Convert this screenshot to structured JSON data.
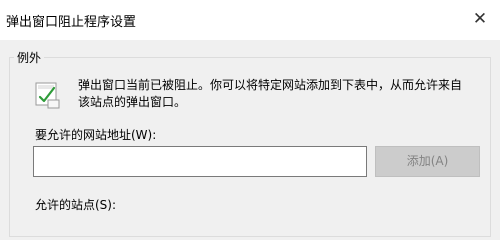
{
  "window": {
    "title": "弹出窗口阻止程序设置",
    "close_glyph": "✕"
  },
  "exceptions": {
    "legend": "例外",
    "info_text": "弹出窗口当前已被阻止。你可以将特定网站添加到下表中，从而允许来自该站点的弹出窗口。",
    "icon": "popup-blocked-icon"
  },
  "address": {
    "label": "要允许的网站地址(W):",
    "value": "",
    "placeholder": ""
  },
  "add_button": {
    "label": "添加(A)"
  },
  "allowed_sites": {
    "label": "允许的站点(S):"
  },
  "colors": {
    "background": "#f0f0f0",
    "titlebar": "#ffffff",
    "button_disabled_bg": "#cccccc",
    "button_disabled_text": "#838383"
  }
}
